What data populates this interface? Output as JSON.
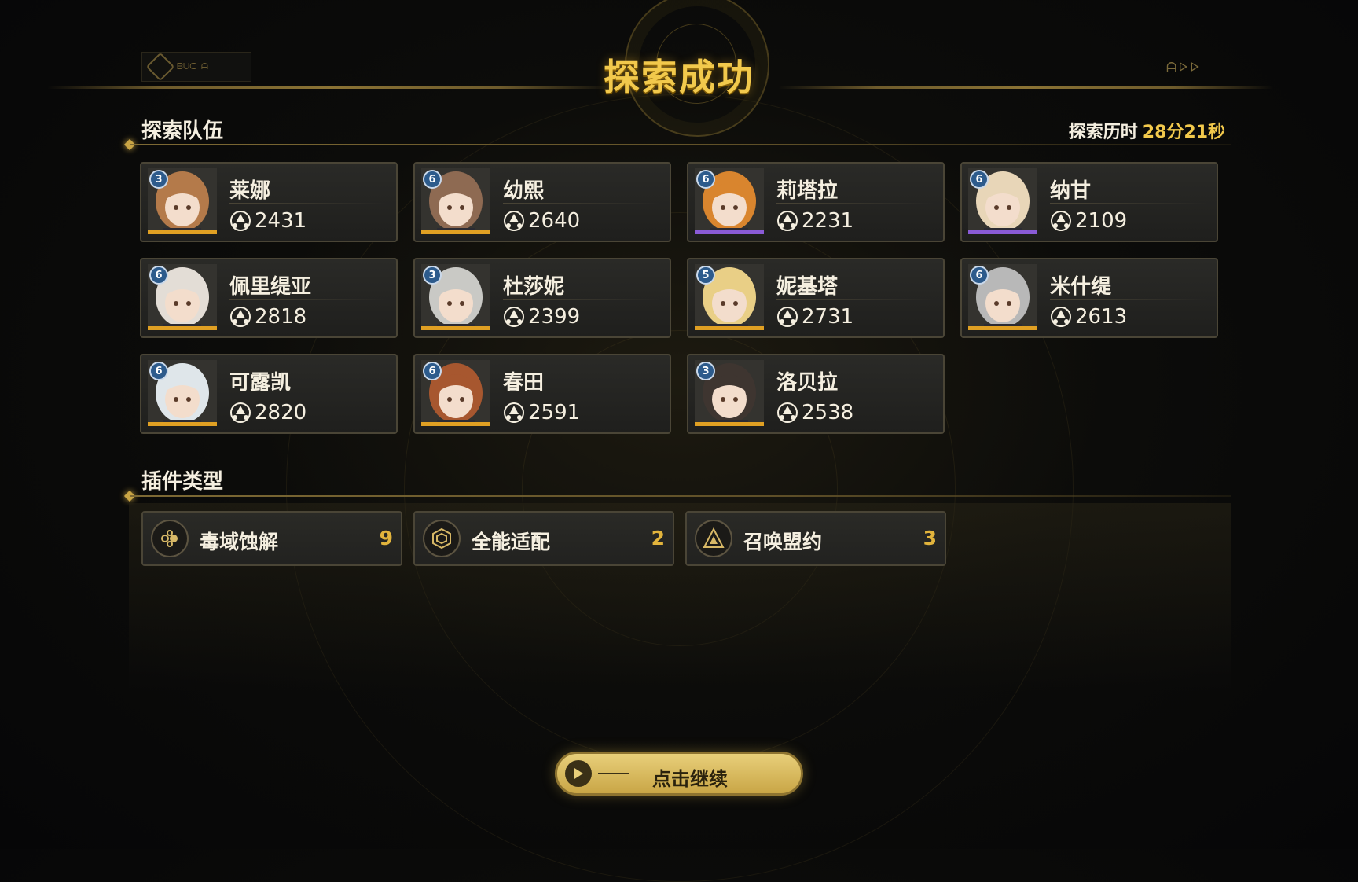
{
  "header": {
    "title": "探索成功",
    "logo_left_text": "ᗷᑌᑕ ᗩ",
    "logo_right_text": "ᗩᐅᐅ"
  },
  "team": {
    "section_title": "探索队伍",
    "elapsed_label": "探索历时",
    "elapsed_value": "28分21秒",
    "members": [
      {
        "name": "莱娜",
        "power": "2431",
        "level": "3",
        "rarity_color": "#e0a023",
        "hair": "#b47a4a"
      },
      {
        "name": "幼熙",
        "power": "2640",
        "level": "6",
        "rarity_color": "#e0a023",
        "hair": "#8e6a52"
      },
      {
        "name": "莉塔拉",
        "power": "2231",
        "level": "6",
        "rarity_color": "#8a5bd6",
        "hair": "#d9852e"
      },
      {
        "name": "纳甘",
        "power": "2109",
        "level": "6",
        "rarity_color": "#8a5bd6",
        "hair": "#e8d6b8"
      },
      {
        "name": "佩里缇亚",
        "power": "2818",
        "level": "6",
        "rarity_color": "#e0a023",
        "hair": "#e3ddd6"
      },
      {
        "name": "杜莎妮",
        "power": "2399",
        "level": "3",
        "rarity_color": "#e0a023",
        "hair": "#c9c9c5"
      },
      {
        "name": "妮基塔",
        "power": "2731",
        "level": "5",
        "rarity_color": "#e0a023",
        "hair": "#e9cf86"
      },
      {
        "name": "米什缇",
        "power": "2613",
        "level": "6",
        "rarity_color": "#e0a023",
        "hair": "#b8b8b8"
      },
      {
        "name": "可露凯",
        "power": "2820",
        "level": "6",
        "rarity_color": "#e0a023",
        "hair": "#dfe6ea"
      },
      {
        "name": "春田",
        "power": "2591",
        "level": "6",
        "rarity_color": "#e0a023",
        "hair": "#a7572f"
      },
      {
        "name": "洛贝拉",
        "power": "2538",
        "level": "3",
        "rarity_color": "#e0a023",
        "hair": "#3e3530"
      }
    ]
  },
  "plugins": {
    "section_title": "插件类型",
    "items": [
      {
        "name": "毒域蚀解",
        "count": "9",
        "icon": "toxic-icon"
      },
      {
        "name": "全能适配",
        "count": "2",
        "icon": "hexagon-icon"
      },
      {
        "name": "召唤盟约",
        "count": "3",
        "icon": "triangle-icon"
      }
    ]
  },
  "continue_button": {
    "label": "点击继续"
  }
}
